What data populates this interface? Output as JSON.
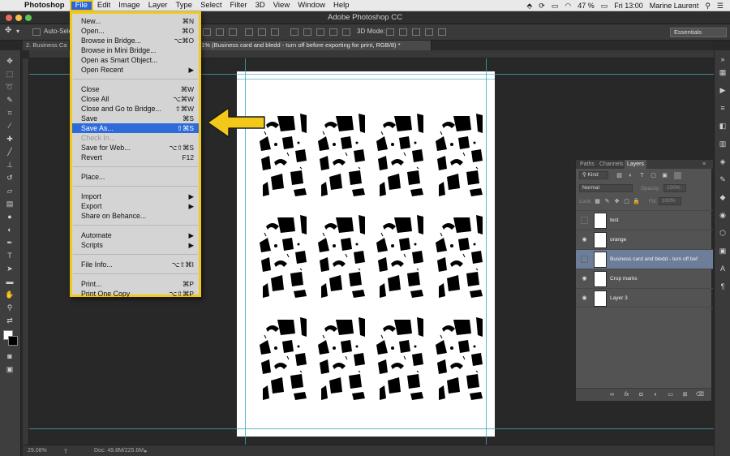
{
  "menubar": {
    "app": "Photoshop",
    "items": [
      "File",
      "Edit",
      "Image",
      "Layer",
      "Type",
      "Select",
      "Filter",
      "3D",
      "View",
      "Window",
      "Help"
    ],
    "battery": "47 %",
    "clock": "Fri 13:00",
    "user": "Marine Laurent"
  },
  "window": {
    "title": "Adobe Photoshop CC"
  },
  "options": {
    "auto_select": "Auto-Select",
    "mode_3d": "3D Mode:",
    "workspace": "Essentials"
  },
  "tabs": [
    {
      "label": "2. Business Ca"
    },
    {
      "label": ".1% (Business card and bledd - turn off before exporting for print, RGB/8) *"
    }
  ],
  "file_menu": [
    {
      "label": "New...",
      "shortcut": "⌘N",
      "disabled": false,
      "highlight": false
    },
    {
      "label": "Open...",
      "shortcut": "⌘O",
      "disabled": false,
      "highlight": false
    },
    {
      "label": "Browse in Bridge...",
      "shortcut": "⌥⌘O",
      "disabled": false,
      "highlight": false
    },
    {
      "label": "Browse in Mini Bridge...",
      "shortcut": "",
      "disabled": false,
      "highlight": false
    },
    {
      "label": "Open as Smart Object...",
      "shortcut": "",
      "disabled": false,
      "highlight": false
    },
    {
      "label": "Open Recent",
      "shortcut": "▶",
      "disabled": false,
      "highlight": false
    },
    {
      "separator": true
    },
    {
      "label": "Close",
      "shortcut": "⌘W",
      "disabled": false,
      "highlight": false
    },
    {
      "label": "Close All",
      "shortcut": "⌥⌘W",
      "disabled": false,
      "highlight": false
    },
    {
      "label": "Close and Go to Bridge...",
      "shortcut": "⇧⌘W",
      "disabled": false,
      "highlight": false
    },
    {
      "label": "Save",
      "shortcut": "⌘S",
      "disabled": false,
      "highlight": false
    },
    {
      "label": "Save As...",
      "shortcut": "⇧⌘S",
      "disabled": false,
      "highlight": true
    },
    {
      "label": "Check In...",
      "shortcut": "",
      "disabled": true,
      "highlight": false
    },
    {
      "label": "Save for Web...",
      "shortcut": "⌥⇧⌘S",
      "disabled": false,
      "highlight": false
    },
    {
      "label": "Revert",
      "shortcut": "F12",
      "disabled": false,
      "highlight": false
    },
    {
      "separator": true
    },
    {
      "label": "Place...",
      "shortcut": "",
      "disabled": false,
      "highlight": false
    },
    {
      "separator": true
    },
    {
      "label": "Import",
      "shortcut": "▶",
      "disabled": false,
      "highlight": false
    },
    {
      "label": "Export",
      "shortcut": "▶",
      "disabled": false,
      "highlight": false
    },
    {
      "label": "Share on Behance...",
      "shortcut": "",
      "disabled": false,
      "highlight": false
    },
    {
      "separator": true
    },
    {
      "label": "Automate",
      "shortcut": "▶",
      "disabled": false,
      "highlight": false
    },
    {
      "label": "Scripts",
      "shortcut": "▶",
      "disabled": false,
      "highlight": false
    },
    {
      "separator": true
    },
    {
      "label": "File Info...",
      "shortcut": "⌥⇧⌘I",
      "disabled": false,
      "highlight": false
    },
    {
      "separator": true
    },
    {
      "label": "Print...",
      "shortcut": "⌘P",
      "disabled": false,
      "highlight": false
    },
    {
      "label": "Print One Copy",
      "shortcut": "⌥⇧⌘P",
      "disabled": false,
      "highlight": false
    }
  ],
  "layers_panel": {
    "tabs": [
      "Paths",
      "Channels",
      "Layers"
    ],
    "filter": "Kind",
    "blend_mode": "Normal",
    "opacity_label": "Opacity:",
    "opacity_value": "100%",
    "lock_label": "Lock:",
    "fill_label": "Fill:",
    "fill_value": "100%",
    "layers": [
      {
        "name": "test",
        "visible": false,
        "selected": false
      },
      {
        "name": "orange",
        "visible": true,
        "selected": false
      },
      {
        "name": "Business card and bledd - turn off bef",
        "visible": false,
        "selected": true
      },
      {
        "name": "Crop marks",
        "visible": true,
        "selected": false
      },
      {
        "name": "Layer 3",
        "visible": true,
        "selected": false
      }
    ]
  },
  "status": {
    "zoom": "29.08%",
    "doc": "Doc: 49.8M/225.6M"
  },
  "colors": {
    "menu_highlight": "#2f6bd8",
    "annotation": "#f2c81a",
    "guide": "#4ab3c4",
    "layer_selected": "#6d7e9a"
  }
}
